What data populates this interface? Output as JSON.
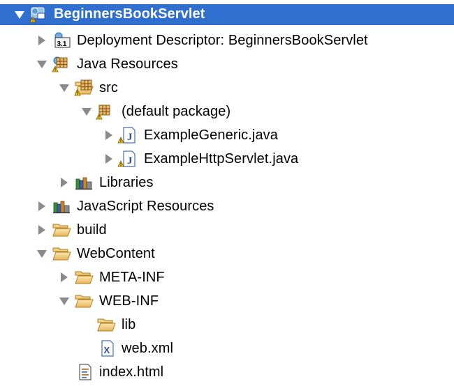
{
  "tree": {
    "project": {
      "label": "BeginnersBookServlet",
      "icon": "web-project-icon",
      "expanded": true,
      "selected": true,
      "selection_color": "#2f6fd0"
    },
    "deployment_descriptor": {
      "label": "Deployment Descriptor: BeginnersBookServlet",
      "icon": "deployment-descriptor-icon",
      "badge": "3.1",
      "expanded": false
    },
    "java_resources": {
      "label": "Java Resources",
      "icon": "java-resources-icon",
      "expanded": true
    },
    "src": {
      "label": "src",
      "icon": "source-folder-icon",
      "expanded": true
    },
    "default_package": {
      "label": "(default package)",
      "icon": "package-icon",
      "expanded": true
    },
    "example_generic": {
      "label": "ExampleGeneric.java",
      "icon": "java-file-icon",
      "expanded": false
    },
    "example_http_servlet": {
      "label": "ExampleHttpServlet.java",
      "icon": "java-file-icon",
      "expanded": false
    },
    "libraries": {
      "label": "Libraries",
      "icon": "libraries-icon",
      "expanded": false
    },
    "javascript_resources": {
      "label": "JavaScript Resources",
      "icon": "javascript-resources-icon",
      "expanded": false
    },
    "build": {
      "label": "build",
      "icon": "folder-icon",
      "expanded": false
    },
    "webcontent": {
      "label": "WebContent",
      "icon": "folder-open-icon",
      "expanded": true
    },
    "meta_inf": {
      "label": "META-INF",
      "icon": "folder-icon",
      "expanded": false
    },
    "web_inf": {
      "label": "WEB-INF",
      "icon": "folder-open-icon",
      "expanded": true
    },
    "lib": {
      "label": "lib",
      "icon": "folder-icon"
    },
    "web_xml": {
      "label": "web.xml",
      "icon": "xml-file-icon"
    },
    "index_html": {
      "label": "index.html",
      "icon": "html-file-icon"
    }
  }
}
